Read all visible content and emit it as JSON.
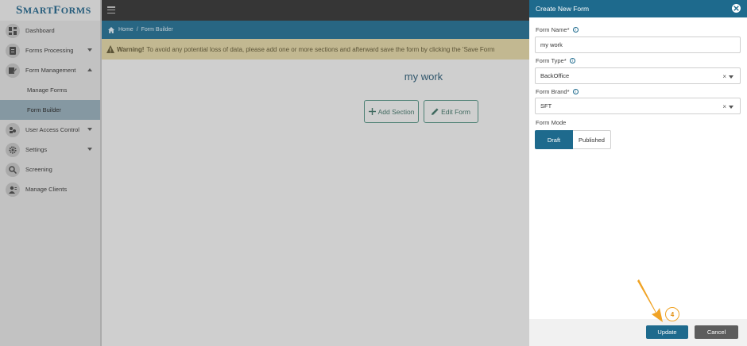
{
  "app": {
    "logo_big_s": "S",
    "logo_mart": "MART ",
    "logo_big_f": "F",
    "logo_orms": "ORMS"
  },
  "sidebar": {
    "items": [
      {
        "label": "Dashboard",
        "icon": "dashboard-icon"
      },
      {
        "label": "Forms Processing",
        "icon": "forms-icon"
      },
      {
        "label": "Form Management",
        "icon": "form-management-icon"
      },
      {
        "label": "Manage Forms"
      },
      {
        "label": "Form Builder"
      },
      {
        "label": "User Access Control",
        "icon": "users-icon"
      },
      {
        "label": "Settings",
        "icon": "gear-icon"
      },
      {
        "label": "Screening",
        "icon": "search-icon"
      },
      {
        "label": "Manage Clients",
        "icon": "client-icon"
      }
    ]
  },
  "breadcrumb": {
    "home": "Home",
    "separator": "/",
    "current": "Form Builder"
  },
  "warning": {
    "bold": "Warning!",
    "text": "To avoid any potential loss of data, please add one or more sections and afterward save the form by clicking the 'Save Form"
  },
  "main": {
    "form_title": "my work",
    "add_section_label": "Add Section",
    "edit_form_label": "Edit Form"
  },
  "panel": {
    "title": "Create New Form",
    "form_name_label": "Form Name*",
    "form_name_value": "my work",
    "form_type_label": "Form Type*",
    "form_type_value": "BackOffice",
    "form_brand_label": "Form Brand*",
    "form_brand_value": "SFT",
    "form_mode_label": "Form Mode",
    "mode_draft": "Draft",
    "mode_published": "Published",
    "clear_symbol": "×",
    "update_label": "Update",
    "cancel_label": "Cancel"
  },
  "annotation": {
    "step": "4"
  },
  "colors": {
    "brand_blue": "#1e6a8d",
    "warning_bg": "#d9ce9e",
    "annotation": "#f0a325"
  }
}
